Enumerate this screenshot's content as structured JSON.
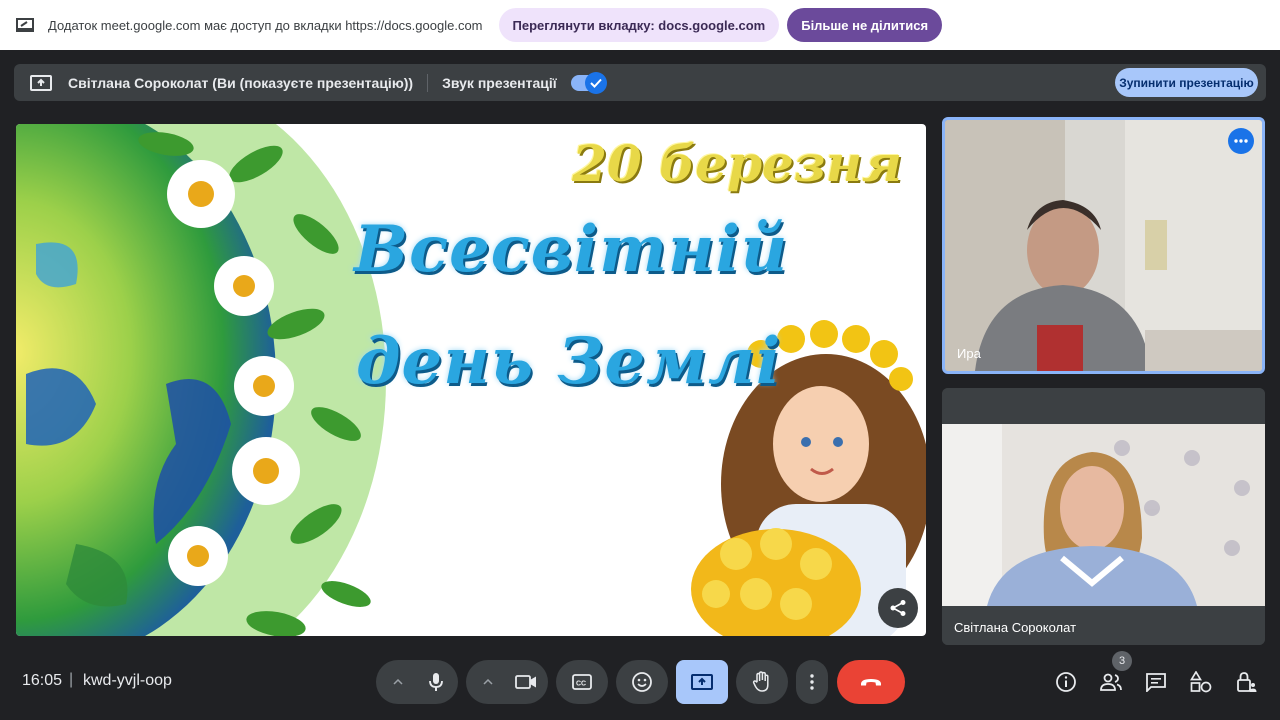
{
  "notification": {
    "text": "Додаток meet.google.com має доступ до вкладки https://docs.google.com",
    "view_tab_label": "Переглянути вкладку: docs.google.com",
    "stop_sharing_label": "Більше не ділитися"
  },
  "present_bar": {
    "presenter_text": "Світлана Сороколат (Ви (показуєте презентацію))",
    "audio_label": "Звук презентації",
    "audio_enabled": true,
    "stop_presenting_label": "Зупинити презентацію"
  },
  "slide": {
    "date_text": "20 березня",
    "title_line1": "Всесвітній",
    "title_line2": "день Землі"
  },
  "participants": [
    {
      "name": "Ира",
      "active_speaker": true
    },
    {
      "name": "Світлана Сороколат",
      "active_speaker": false
    }
  ],
  "meeting": {
    "time": "16:05",
    "separator": "|",
    "code": "kwd-yvjl-oop",
    "participant_count": "3"
  },
  "colors": {
    "accent": "#8ab4f8",
    "present_button": "#a8c7fa",
    "end_call": "#ea4335",
    "notification_purple": "#6b4a9b"
  }
}
